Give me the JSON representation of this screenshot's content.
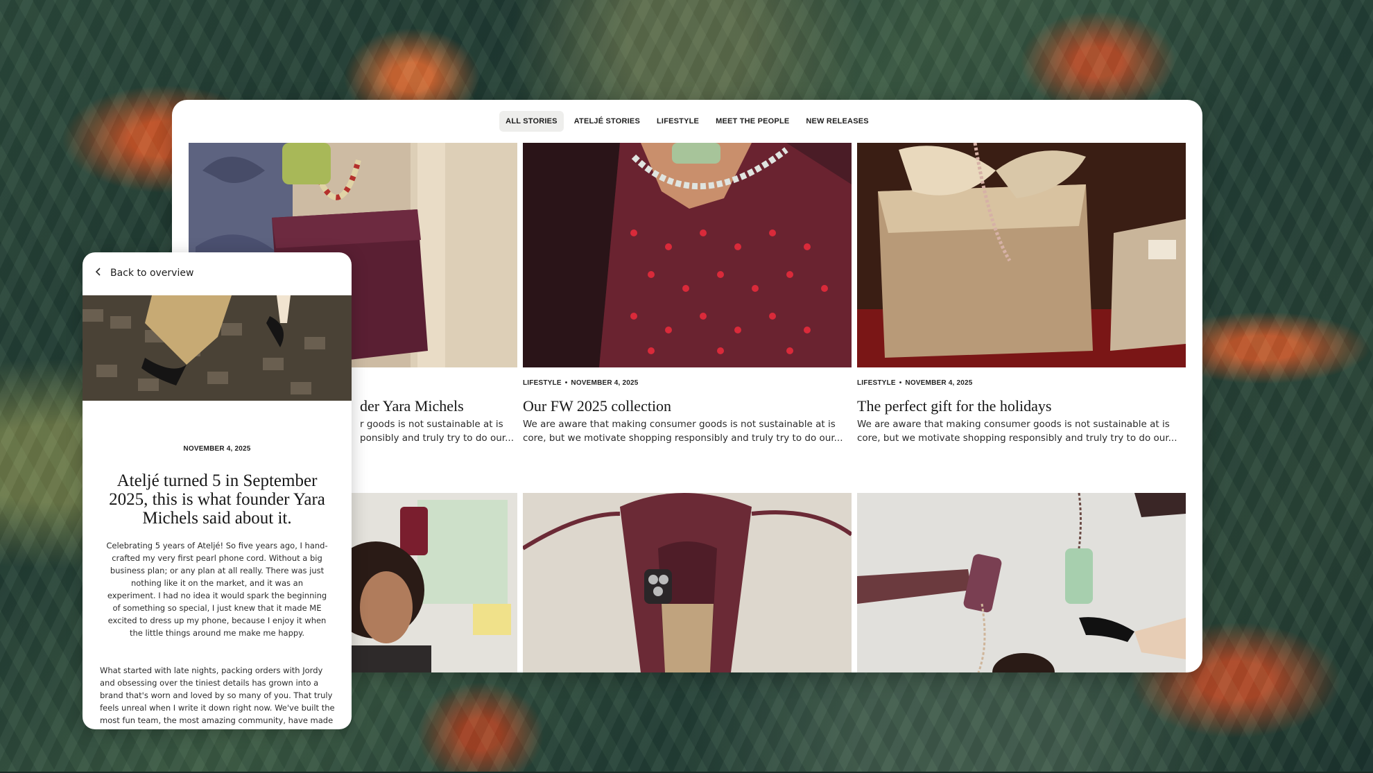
{
  "nav": {
    "tabs": [
      {
        "label": "ALL STORIES",
        "active": true
      },
      {
        "label": "ATELJÉ STORIES",
        "active": false
      },
      {
        "label": "LIFESTYLE",
        "active": false
      },
      {
        "label": "MEET THE PEOPLE",
        "active": false
      },
      {
        "label": "NEW RELEASES",
        "active": false
      }
    ]
  },
  "cards": [
    {
      "image": "burgundy-bag-with-beaded-strap",
      "category": "",
      "date": "",
      "title": "Ateljé turned 5 in September 2025, this is what founder Yara Michels",
      "title_visible": "der Yara Michels",
      "excerpt_visible_1": "r goods is not sustainable at is",
      "excerpt_visible_2": "ponsibly and truly try to do our..."
    },
    {
      "image": "red-polka-dot-dress-pearl-cord",
      "category": "LIFESTYLE",
      "date": "NOVEMBER 4, 2025",
      "title": "Our FW 2025 collection",
      "excerpt": "We are aware that making consumer goods is not sustainable at is core, but we motivate shopping responsibly and truly try to do our..."
    },
    {
      "image": "wrapped-gift-with-beaded-cord",
      "category": "LIFESTYLE",
      "date": "NOVEMBER 4, 2025",
      "title": "The perfect gift for the holidays",
      "excerpt": "We are aware that making consumer goods is not sustainable at is core, but we motivate shopping responsibly and truly try to do our..."
    },
    {
      "image": "woman-with-phone-cases-on-board"
    },
    {
      "image": "burgundy-bag-top-view-with-phone"
    },
    {
      "image": "hands-holding-phones-on-cords"
    }
  ],
  "meta_separator": "•",
  "detail": {
    "back_label": "Back to overview",
    "date": "NOVEMBER 4, 2025",
    "title": "Ateljé turned 5 in September 2025, this is what founder Yara Michels said about it.",
    "paragraph_1": "Celebrating 5 years of Ateljé! So five years ago, I hand-crafted my very first pearl phone cord. Without a big business plan; or any plan at all really. There was just nothing like it on the market, and it was an experiment. I had no idea it would spark the beginning of something so special, I just knew that it made ME excited to dress up my phone, because I enjoy it when the little things around me make me happy.",
    "paragraph_2": "What started with late nights, packing orders with Jordy and obsessing over the tiniest details has grown into a brand that's worn and loved by so many of you. That truly feels unreal when I write it down right now. We've built the most fun team, the most amazing community, have made"
  },
  "colors": {
    "accent": "#eeeeec",
    "burgundy": "#6b2a36",
    "text": "#161616"
  },
  "icons": [
    "chevron-left-icon"
  ]
}
